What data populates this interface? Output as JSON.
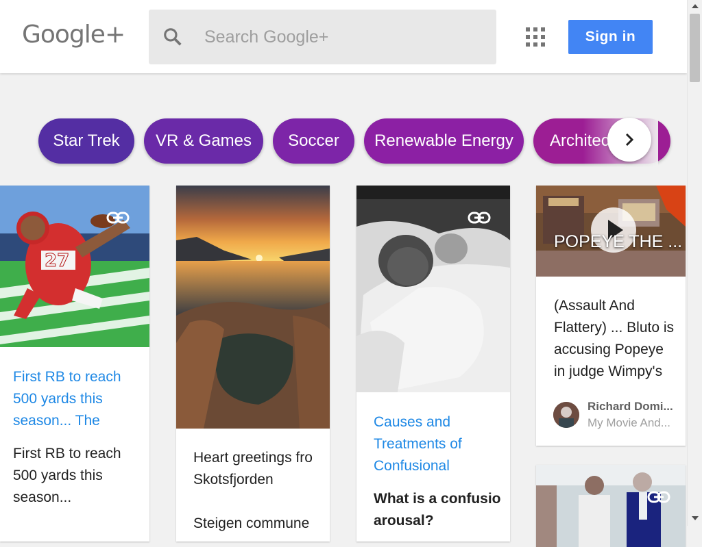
{
  "header": {
    "logo": "Google+",
    "search_placeholder": "Search Google+",
    "signin_label": "Sign in"
  },
  "chips": [
    {
      "label": "Star Trek",
      "color": "#5a2ea6"
    },
    {
      "label": "VR & Games",
      "color": "#6a2aa9"
    },
    {
      "label": "Soccer",
      "color": "#7b24a8"
    },
    {
      "label": "Renewable Energy",
      "color": "#8a20a4"
    },
    {
      "label": "Architecture",
      "color": "#9b1e96"
    }
  ],
  "cards": {
    "football": {
      "link": "First RB to reach 500 yards this season... The",
      "text": "First RB to reach 500 yards this season..."
    },
    "sunset": {
      "text": "Heart greetings fro Skotsfjorden",
      "text2": "Steigen commune"
    },
    "babies": {
      "link": "Causes and Treatments of Confusional",
      "bold": "What is a confusio arousal?"
    },
    "popeye": {
      "video_title": "POPEYE THE ...",
      "text": "(Assault And Flattery) ... Bluto is accusing Popeye in judge Wimpy's",
      "author_name": "Richard Domi...",
      "author_sub": "My Movie And..."
    }
  },
  "colors": {
    "accent": "#4285f4",
    "link": "#1e88e5",
    "background": "#f1f1f1"
  },
  "icons": [
    "search-icon",
    "apps-grid-icon",
    "chevron-right-icon",
    "link-icon",
    "play-icon"
  ]
}
